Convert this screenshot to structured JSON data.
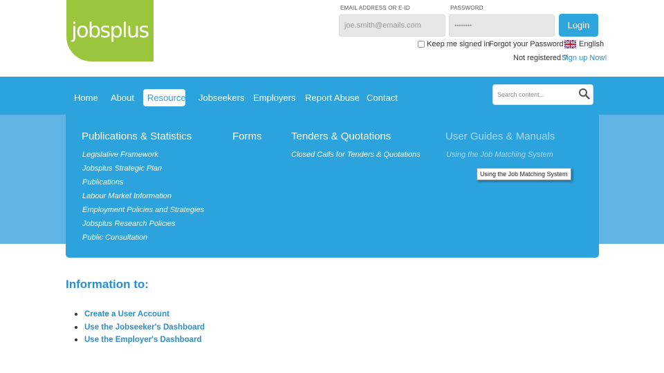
{
  "logo": {
    "text": "jobsplus"
  },
  "login": {
    "email_label": "EMAIL ADDRESS OR E-ID",
    "email_placeholder": "joe.smith@emails.com",
    "password_label": "PASSWORD",
    "password_value": "••••••••",
    "login_label": "Login",
    "keep_signed_in": "Keep me signed in",
    "forgot_password": "Forgot your Password?",
    "language": "English",
    "not_registered": "Not registered ?",
    "sign_up": "Sign up Now!"
  },
  "nav": {
    "items": [
      {
        "label": "Home"
      },
      {
        "label": "About"
      },
      {
        "label": "Resources",
        "active": true
      },
      {
        "label": "Jobseekers"
      },
      {
        "label": "Employers"
      },
      {
        "label": "Report Abuse"
      },
      {
        "label": "Contact"
      }
    ],
    "search_placeholder": "Search content..."
  },
  "dropdown": {
    "columns": [
      {
        "heading": "Publications & Statistics",
        "links": [
          "Legislative Framework",
          "Jobsplus Strategic Plan",
          "Publications",
          "Labour Market Information",
          "Employment Policies and Strategies",
          "Jobsplus Research Policies",
          "Public Consultation"
        ]
      },
      {
        "heading": "Forms",
        "links": []
      },
      {
        "heading": "Tenders & Quotations",
        "links": [
          "Closed Calls for Tenders & Quotations"
        ]
      },
      {
        "heading": "User Guides & Manuals",
        "links": [
          "Using the Job Matching System"
        ]
      }
    ],
    "tooltip": "Using the Job Matching System"
  },
  "info": {
    "title": "Information to:",
    "items": [
      "Create a User Account",
      "Use the Jobseeker's Dashboard",
      "Use the Employer's Dashboard"
    ]
  },
  "colors": {
    "brand_green": "#9bc53d",
    "nav_blue": "#2da3dd",
    "band_blue": "#5fb4e5",
    "link_blue": "#2a8fd0"
  }
}
